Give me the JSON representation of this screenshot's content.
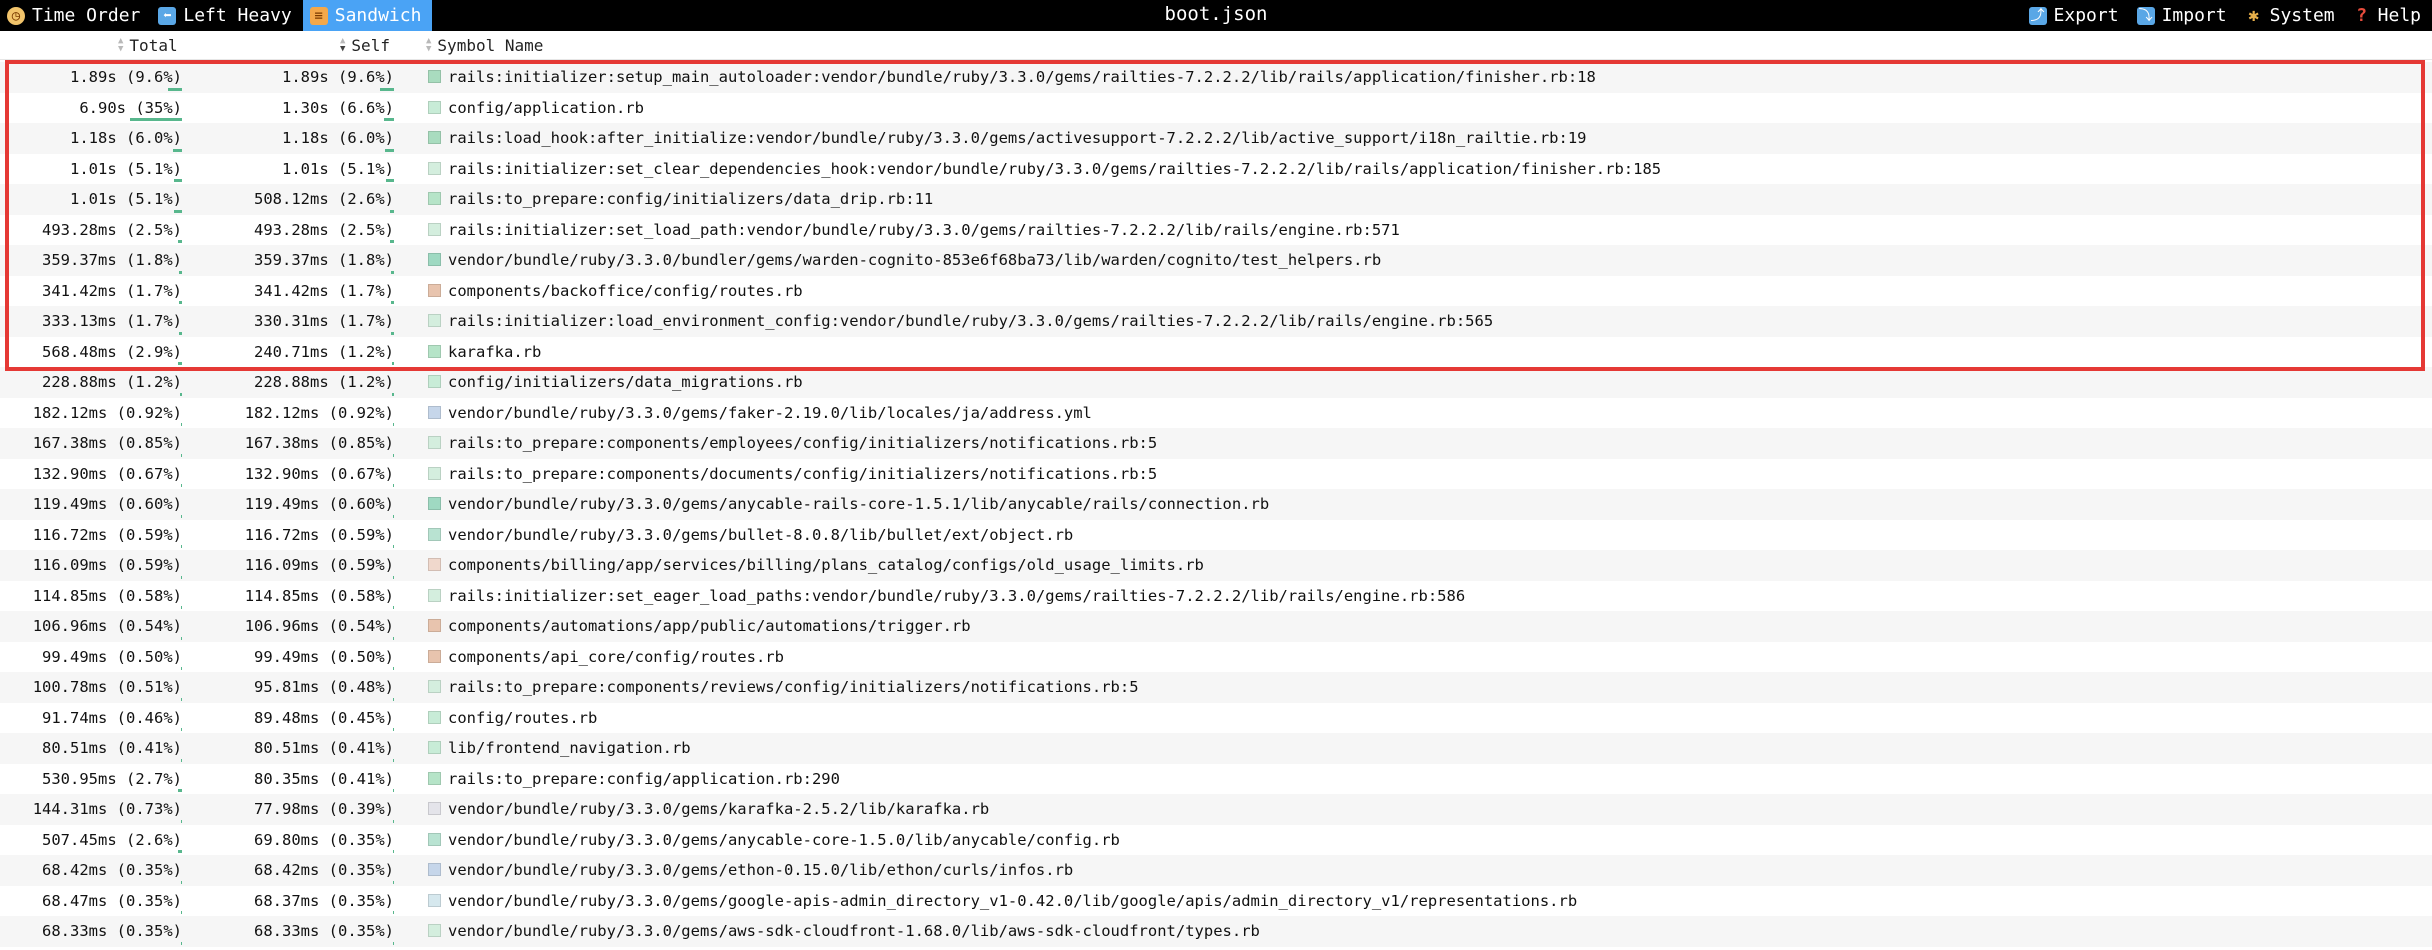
{
  "toolbar": {
    "left": [
      {
        "label": "Time Order",
        "icon": "clock-icon",
        "active": false
      },
      {
        "label": "Left Heavy",
        "icon": "left-heavy-icon",
        "active": false
      },
      {
        "label": "Sandwich",
        "icon": "sandwich-icon",
        "active": true
      }
    ],
    "title": "boot.json",
    "right": [
      {
        "label": "Export",
        "icon": "export-icon"
      },
      {
        "label": "Import",
        "icon": "import-icon"
      },
      {
        "label": "System",
        "icon": "palette-icon"
      },
      {
        "label": "Help",
        "icon": "help-icon"
      }
    ]
  },
  "table": {
    "headers": {
      "total": "Total",
      "self": "Self",
      "name": "Symbol Name"
    },
    "sorted_by": "Self",
    "rows": [
      {
        "total": "1.89s (9.6%)",
        "total_pct": 9.6,
        "self": "1.89s (9.6%)",
        "self_pct": 9.6,
        "name": "rails:initializer:setup_main_autoloader:vendor/bundle/ruby/3.3.0/gems/railties-7.2.2.2/lib/rails/application/finisher.rb:18",
        "color": "#a9dcbf"
      },
      {
        "total": "6.90s (35%)",
        "total_pct": 35,
        "self": "1.30s (6.6%)",
        "self_pct": 6.6,
        "name": "config/application.rb",
        "color": "#c8ecd7"
      },
      {
        "total": "1.18s (6.0%)",
        "total_pct": 6.0,
        "self": "1.18s (6.0%)",
        "self_pct": 6.0,
        "name": "rails:load_hook:after_initialize:vendor/bundle/ruby/3.3.0/gems/activesupport-7.2.2.2/lib/active_support/i18n_railtie.rb:19",
        "color": "#a9dcbf"
      },
      {
        "total": "1.01s (5.1%)",
        "total_pct": 5.1,
        "self": "1.01s (5.1%)",
        "self_pct": 5.1,
        "name": "rails:initializer:set_clear_dependencies_hook:vendor/bundle/ruby/3.3.0/gems/railties-7.2.2.2/lib/rails/application/finisher.rb:185",
        "color": "#d4eede"
      },
      {
        "total": "1.01s (5.1%)",
        "total_pct": 5.1,
        "self": "508.12ms (2.6%)",
        "self_pct": 2.6,
        "name": "rails:to_prepare:config/initializers/data_drip.rb:11",
        "color": "#b6e4c8"
      },
      {
        "total": "493.28ms (2.5%)",
        "total_pct": 2.5,
        "self": "493.28ms (2.5%)",
        "self_pct": 2.5,
        "name": "rails:initializer:set_load_path:vendor/bundle/ruby/3.3.0/gems/railties-7.2.2.2/lib/rails/engine.rb:571",
        "color": "#d4eede"
      },
      {
        "total": "359.37ms (1.8%)",
        "total_pct": 1.8,
        "self": "359.37ms (1.8%)",
        "self_pct": 1.8,
        "name": "vendor/bundle/ruby/3.3.0/bundler/gems/warden-cognito-853e6f68ba73/lib/warden/cognito/test_helpers.rb",
        "color": "#9fd9c2"
      },
      {
        "total": "341.42ms (1.7%)",
        "total_pct": 1.7,
        "self": "341.42ms (1.7%)",
        "self_pct": 1.7,
        "name": "components/backoffice/config/routes.rb",
        "color": "#e8c4ae"
      },
      {
        "total": "333.13ms (1.7%)",
        "total_pct": 1.7,
        "self": "330.31ms (1.7%)",
        "self_pct": 1.7,
        "name": "rails:initializer:load_environment_config:vendor/bundle/ruby/3.3.0/gems/railties-7.2.2.2/lib/rails/engine.rb:565",
        "color": "#d4eede"
      },
      {
        "total": "568.48ms (2.9%)",
        "total_pct": 2.9,
        "self": "240.71ms (1.2%)",
        "self_pct": 1.2,
        "name": "karafka.rb",
        "color": "#b6e4c8"
      },
      {
        "total": "228.88ms (1.2%)",
        "total_pct": 1.2,
        "self": "228.88ms (1.2%)",
        "self_pct": 1.2,
        "name": "config/initializers/data_migrations.rb",
        "color": "#c8ecd7"
      },
      {
        "total": "182.12ms (0.92%)",
        "total_pct": 0.92,
        "self": "182.12ms (0.92%)",
        "self_pct": 0.92,
        "name": "vendor/bundle/ruby/3.3.0/gems/faker-2.19.0/lib/locales/ja/address.yml",
        "color": "#c6d6ea"
      },
      {
        "total": "167.38ms (0.85%)",
        "total_pct": 0.85,
        "self": "167.38ms (0.85%)",
        "self_pct": 0.85,
        "name": "rails:to_prepare:components/employees/config/initializers/notifications.rb:5",
        "color": "#d4eede"
      },
      {
        "total": "132.90ms (0.67%)",
        "total_pct": 0.67,
        "self": "132.90ms (0.67%)",
        "self_pct": 0.67,
        "name": "rails:to_prepare:components/documents/config/initializers/notifications.rb:5",
        "color": "#d4eede"
      },
      {
        "total": "119.49ms (0.60%)",
        "total_pct": 0.6,
        "self": "119.49ms (0.60%)",
        "self_pct": 0.6,
        "name": "vendor/bundle/ruby/3.3.0/gems/anycable-rails-core-1.5.1/lib/anycable/rails/connection.rb",
        "color": "#9fd9c2"
      },
      {
        "total": "116.72ms (0.59%)",
        "total_pct": 0.59,
        "self": "116.72ms (0.59%)",
        "self_pct": 0.59,
        "name": "vendor/bundle/ruby/3.3.0/gems/bullet-8.0.8/lib/bullet/ext/object.rb",
        "color": "#b9e3d2"
      },
      {
        "total": "116.09ms (0.59%)",
        "total_pct": 0.59,
        "self": "116.09ms (0.59%)",
        "self_pct": 0.59,
        "name": "components/billing/app/services/billing/plans_catalog/configs/old_usage_limits.rb",
        "color": "#f0d8cc"
      },
      {
        "total": "114.85ms (0.58%)",
        "total_pct": 0.58,
        "self": "114.85ms (0.58%)",
        "self_pct": 0.58,
        "name": "rails:initializer:set_eager_load_paths:vendor/bundle/ruby/3.3.0/gems/railties-7.2.2.2/lib/rails/engine.rb:586",
        "color": "#d4eede"
      },
      {
        "total": "106.96ms (0.54%)",
        "total_pct": 0.54,
        "self": "106.96ms (0.54%)",
        "self_pct": 0.54,
        "name": "components/automations/app/public/automations/trigger.rb",
        "color": "#e8c4ae"
      },
      {
        "total": "99.49ms (0.50%)",
        "total_pct": 0.5,
        "self": "99.49ms (0.50%)",
        "self_pct": 0.5,
        "name": "components/api_core/config/routes.rb",
        "color": "#e8c4ae"
      },
      {
        "total": "100.78ms (0.51%)",
        "total_pct": 0.51,
        "self": "95.81ms (0.48%)",
        "self_pct": 0.48,
        "name": "rails:to_prepare:components/reviews/config/initializers/notifications.rb:5",
        "color": "#d4eede"
      },
      {
        "total": "91.74ms (0.46%)",
        "total_pct": 0.46,
        "self": "89.48ms (0.45%)",
        "self_pct": 0.45,
        "name": "config/routes.rb",
        "color": "#c8ecd7"
      },
      {
        "total": "80.51ms (0.41%)",
        "total_pct": 0.41,
        "self": "80.51ms (0.41%)",
        "self_pct": 0.41,
        "name": "lib/frontend_navigation.rb",
        "color": "#c8ecd7"
      },
      {
        "total": "530.95ms (2.7%)",
        "total_pct": 2.7,
        "self": "80.35ms (0.41%)",
        "self_pct": 0.41,
        "name": "rails:to_prepare:config/application.rb:290",
        "color": "#b6e4c8"
      },
      {
        "total": "144.31ms (0.73%)",
        "total_pct": 0.73,
        "self": "77.98ms (0.39%)",
        "self_pct": 0.39,
        "name": "vendor/bundle/ruby/3.3.0/gems/karafka-2.5.2/lib/karafka.rb",
        "color": "#e4e4ea"
      },
      {
        "total": "507.45ms (2.6%)",
        "total_pct": 2.6,
        "self": "69.80ms (0.35%)",
        "self_pct": 0.35,
        "name": "vendor/bundle/ruby/3.3.0/gems/anycable-core-1.5.0/lib/anycable/config.rb",
        "color": "#b9e3d2"
      },
      {
        "total": "68.42ms (0.35%)",
        "total_pct": 0.35,
        "self": "68.42ms (0.35%)",
        "self_pct": 0.35,
        "name": "vendor/bundle/ruby/3.3.0/gems/ethon-0.15.0/lib/ethon/curls/infos.rb",
        "color": "#c6d6ea"
      },
      {
        "total": "68.47ms (0.35%)",
        "total_pct": 0.35,
        "self": "68.37ms (0.35%)",
        "self_pct": 0.35,
        "name": "vendor/bundle/ruby/3.3.0/gems/google-apis-admin_directory_v1-0.42.0/lib/google/apis/admin_directory_v1/representations.rb",
        "color": "#d6e8ee"
      },
      {
        "total": "68.33ms (0.35%)",
        "total_pct": 0.35,
        "self": "68.33ms (0.35%)",
        "self_pct": 0.35,
        "name": "vendor/bundle/ruby/3.3.0/gems/aws-sdk-cloudfront-1.68.0/lib/aws-sdk-cloudfront/types.rb",
        "color": "#d4eede"
      }
    ]
  },
  "highlight": {
    "first_row": 0,
    "last_row": 9,
    "color": "#e53935"
  }
}
